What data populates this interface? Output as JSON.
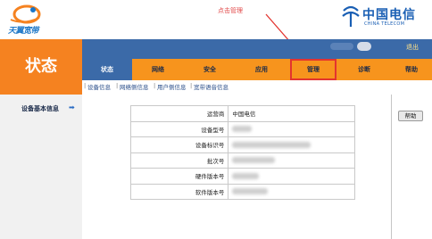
{
  "header": {
    "brand_left": "天翼宽带",
    "brand_right_cn": "中国电信",
    "brand_right_en": "CHINA TELECOM",
    "annotation": "点击管理",
    "logout": "退出"
  },
  "status_title": "状态",
  "tabs": [
    {
      "label": "状态",
      "active": true
    },
    {
      "label": "网络"
    },
    {
      "label": "安全"
    },
    {
      "label": "应用"
    },
    {
      "label": "管理",
      "highlighted": true
    },
    {
      "label": "诊断"
    },
    {
      "label": "帮助"
    }
  ],
  "subnav": [
    "设备信息",
    "网络侧信息",
    "用户侧信息",
    "宽带语音信息"
  ],
  "sidebar": {
    "label": "设备基本信息"
  },
  "info_table": [
    {
      "label": "运营商",
      "value": "中国电信"
    },
    {
      "label": "设备型号",
      "value": ""
    },
    {
      "label": "设备标识号",
      "value": ""
    },
    {
      "label": "批次号",
      "value": ""
    },
    {
      "label": "硬件版本号",
      "value": ""
    },
    {
      "label": "软件版本号",
      "value": ""
    }
  ],
  "help_button": "帮助",
  "colors": {
    "accent_orange": "#f58220",
    "nav_blue": "#3b6aa8",
    "highlight_red": "#e3342f"
  }
}
